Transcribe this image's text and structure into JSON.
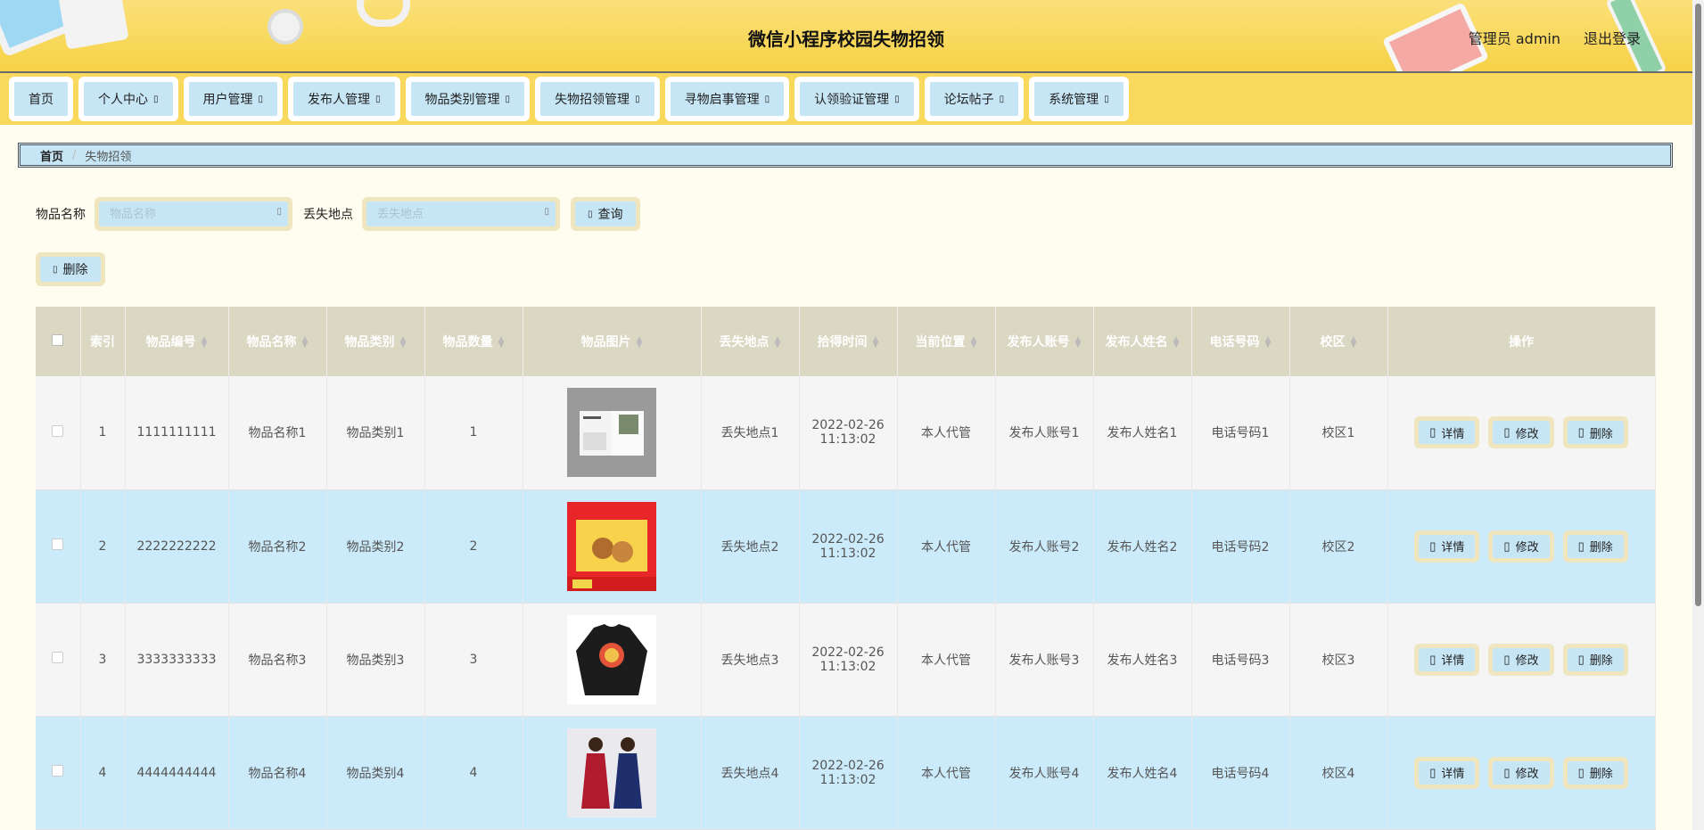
{
  "header": {
    "title": "微信小程序校园失物招领",
    "user": "管理员 admin",
    "logout": "退出登录"
  },
  "nav": [
    {
      "label": "首页",
      "has_caret": false
    },
    {
      "label": "个人中心",
      "has_caret": true
    },
    {
      "label": "用户管理",
      "has_caret": true
    },
    {
      "label": "发布人管理",
      "has_caret": true
    },
    {
      "label": "物品类别管理",
      "has_caret": true
    },
    {
      "label": "失物招领管理",
      "has_caret": true
    },
    {
      "label": "寻物启事管理",
      "has_caret": true
    },
    {
      "label": "认领验证管理",
      "has_caret": true
    },
    {
      "label": "论坛帖子",
      "has_caret": true
    },
    {
      "label": "系统管理",
      "has_caret": true
    }
  ],
  "breadcrumb": {
    "home": "首页",
    "current": "失物招领"
  },
  "search": {
    "name_label": "物品名称",
    "name_placeholder": "物品名称",
    "place_label": "丢失地点",
    "place_placeholder": "丢失地点",
    "query_button": "查询",
    "delete_button": "删除"
  },
  "table": {
    "columns": [
      "索引",
      "物品编号",
      "物品名称",
      "物品类别",
      "物品数量",
      "物品图片",
      "丢失地点",
      "拾得时间",
      "当前位置",
      "发布人账号",
      "发布人姓名",
      "电话号码",
      "校区",
      "操作"
    ],
    "rows": [
      {
        "index": "1",
        "code": "1111111111",
        "name": "物品名称1",
        "category": "物品类别1",
        "qty": "1",
        "place": "丢失地点1",
        "date": "2022-02-26",
        "time": "11:13:02",
        "location": "本人代管",
        "account": "发布人账号1",
        "publisher": "发布人姓名1",
        "phone": "电话号码1",
        "campus": "校区1",
        "image": "book"
      },
      {
        "index": "2",
        "code": "2222222222",
        "name": "物品名称2",
        "category": "物品类别2",
        "qty": "2",
        "place": "丢失地点2",
        "date": "2022-02-26",
        "time": "11:13:02",
        "location": "本人代管",
        "account": "发布人账号2",
        "publisher": "发布人姓名2",
        "phone": "电话号码2",
        "campus": "校区2",
        "image": "snack-box"
      },
      {
        "index": "3",
        "code": "3333333333",
        "name": "物品名称3",
        "category": "物品类别3",
        "qty": "3",
        "place": "丢失地点3",
        "date": "2022-02-26",
        "time": "11:13:02",
        "location": "本人代管",
        "account": "发布人账号3",
        "publisher": "发布人姓名3",
        "phone": "电话号码3",
        "campus": "校区3",
        "image": "sweatshirt"
      },
      {
        "index": "4",
        "code": "4444444444",
        "name": "物品名称4",
        "category": "物品类别4",
        "qty": "4",
        "place": "丢失地点4",
        "date": "2022-02-26",
        "time": "11:13:02",
        "location": "本人代管",
        "account": "发布人账号4",
        "publisher": "发布人姓名4",
        "phone": "电话号码4",
        "campus": "校区4",
        "image": "dresses"
      }
    ],
    "ops": [
      "详情",
      "修改",
      "删除"
    ]
  }
}
